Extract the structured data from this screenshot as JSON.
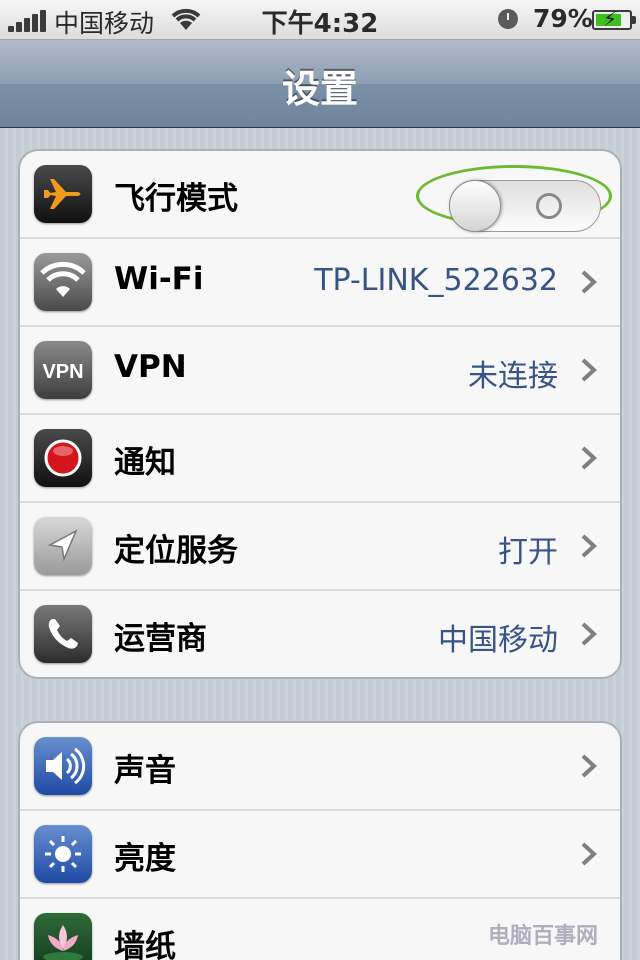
{
  "status_bar": {
    "carrier": "中国移动",
    "time": "下午4:32",
    "battery_percent_text": "79%",
    "battery_level": 0.79,
    "signal_bars": 5
  },
  "nav": {
    "title": "设置"
  },
  "group1": [
    {
      "id": "airplane",
      "label": "飞行模式",
      "icon": "airplane-icon",
      "toggle": "off"
    },
    {
      "id": "wifi",
      "label": "Wi-Fi",
      "value": "TP-LINK_522632",
      "icon": "wifi-icon"
    },
    {
      "id": "vpn",
      "label": "VPN",
      "value": "未连接",
      "icon": "vpn-icon",
      "icon_text": "VPN"
    },
    {
      "id": "notifications",
      "label": "通知",
      "value": "",
      "icon": "notification-icon"
    },
    {
      "id": "location",
      "label": "定位服务",
      "value": "打开",
      "icon": "location-arrow-icon"
    },
    {
      "id": "carrier",
      "label": "运营商",
      "value": "中国移动",
      "icon": "phone-icon"
    }
  ],
  "group2": [
    {
      "id": "sounds",
      "label": "声音",
      "icon": "speaker-icon"
    },
    {
      "id": "brightness",
      "label": "亮度",
      "icon": "sun-icon"
    },
    {
      "id": "wallpaper",
      "label": "墙纸",
      "icon": "lotus-icon"
    }
  ],
  "colors": {
    "value_text": "#385487",
    "highlight_circle": "#6cba32",
    "nav_bar": "#8d9fb3"
  },
  "watermark": "电脑百事网"
}
